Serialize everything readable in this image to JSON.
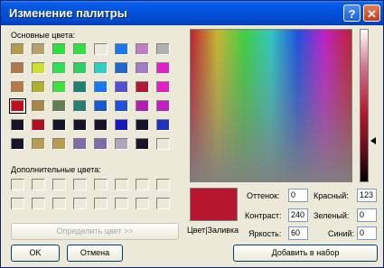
{
  "window": {
    "title": "Изменение палитры"
  },
  "titlebar": {
    "help_glyph": "?",
    "close_glyph": "✕"
  },
  "labels": {
    "basic_colors": "Основные цвета:",
    "custom_colors": "Дополнительные цвета:",
    "color_solid": "Цвет|Заливка"
  },
  "basic_colors": [
    "#b89a4e",
    "#b8a06a",
    "#30e040",
    "#30e040",
    "#ece9d8",
    "#1878f0",
    "#c080c0",
    "#b0b0b0",
    "#b07848",
    "#d0e030",
    "#30e050",
    "#30d060",
    "#30d0c0",
    "#2068d0",
    "#a080c0",
    "#e020c8",
    "#b87848",
    "#b0b030",
    "#40e040",
    "#208070",
    "#1878f0",
    "#5050d0",
    "#b01838",
    "#e020c0",
    "#c01020",
    "#a8884a",
    "#608050",
    "#288070",
    "#1858d0",
    "#2050e0",
    "#b020b0",
    "#c020c0",
    "#181428",
    "#b01020",
    "#181428",
    "#181428",
    "#181428",
    "#1818c0",
    "#181428",
    "#2030c0",
    "#181428",
    "#b89c50",
    "#b89c50",
    "#806aa8",
    "#806aa8",
    "#b0a4b8",
    "#181428",
    "#ece9d8"
  ],
  "selected_basic_index": 24,
  "custom_count": 16,
  "spectrum_colors": [
    "#c02030",
    "#c8b830",
    "#40d040",
    "#30c8c0",
    "#2050e0",
    "#c020c8",
    "#c02030"
  ],
  "buttons": {
    "define": "Определить цвет >>",
    "ok": "OK",
    "cancel": "Отмена",
    "add": "Добавить в набор"
  },
  "fields": {
    "hue_label": "Оттенок:",
    "hue_value": "0",
    "sat_label": "Контраст:",
    "sat_value": "240",
    "lum_label": "Яркость:",
    "lum_value": "60",
    "red_label": "Красный:",
    "red_value": "123",
    "green_label": "Зеленый:",
    "green_value": "0",
    "blue_label": "Синий:",
    "blue_value": "0"
  },
  "preview_color": "#b7172e"
}
